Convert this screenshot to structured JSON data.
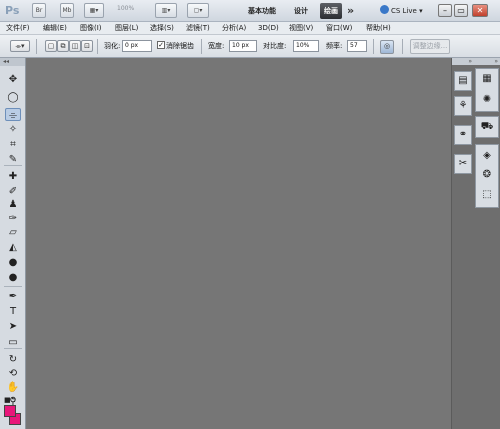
{
  "appbar": {
    "logo": "Ps",
    "mb_label": "Mb",
    "zoom": "100%",
    "workspaces": [
      "基本功能",
      "设计",
      "绘画"
    ],
    "active_workspace": "绘画",
    "more": "»",
    "cs_live": "CS Live",
    "window_controls": [
      "minimize",
      "restore",
      "close"
    ]
  },
  "menu": {
    "items": [
      "文件(F)",
      "编辑(E)",
      "图像(I)",
      "图层(L)",
      "选择(S)",
      "滤镜(T)",
      "分析(A)",
      "3D(D)",
      "视图(V)",
      "窗口(W)",
      "帮助(H)"
    ]
  },
  "options": {
    "feather_label": "羽化:",
    "feather_value": "0 px",
    "antialias_label": "消除锯齿",
    "antialias_checked": true,
    "width_label": "宽度:",
    "width_value": "10 px",
    "contrast_label": "对比度:",
    "contrast_value": "10%",
    "frequency_label": "频率:",
    "frequency_value": "57",
    "refine_edge_label": "调整边缘..."
  },
  "toolbox": {
    "tools": [
      {
        "name": "move-tool",
        "icon": "move-icon",
        "glyph": "✥"
      },
      {
        "name": "marquee-tool",
        "icon": "ellipse-marquee-icon",
        "glyph": "◯"
      },
      {
        "name": "magnetic-lasso-tool",
        "icon": "magnetic-lasso-icon",
        "glyph": "⌯",
        "active": true
      },
      {
        "name": "quick-selection-tool",
        "icon": "magic-wand-icon",
        "glyph": "✧"
      },
      {
        "name": "crop-tool",
        "icon": "crop-icon",
        "glyph": "⌗"
      },
      {
        "name": "eyedropper-tool",
        "icon": "eyedropper-icon",
        "glyph": "✎"
      },
      {
        "name": "spot-healing-tool",
        "icon": "bandage-icon",
        "glyph": "✚"
      },
      {
        "name": "brush-tool",
        "icon": "brush-icon",
        "glyph": "✐"
      },
      {
        "name": "clone-stamp-tool",
        "icon": "stamp-icon",
        "glyph": "♟"
      },
      {
        "name": "history-brush-tool",
        "icon": "history-brush-icon",
        "glyph": "✑"
      },
      {
        "name": "eraser-tool",
        "icon": "eraser-icon",
        "glyph": "▱"
      },
      {
        "name": "paint-bucket-tool",
        "icon": "paint-bucket-icon",
        "glyph": "◭"
      },
      {
        "name": "blur-tool",
        "icon": "blur-drop-icon",
        "glyph": "●"
      },
      {
        "name": "dodge-tool",
        "icon": "dodge-icon",
        "glyph": "●"
      },
      {
        "name": "pen-tool",
        "icon": "pen-icon",
        "glyph": "✒"
      },
      {
        "name": "type-tool",
        "icon": "type-icon",
        "glyph": "T"
      },
      {
        "name": "path-selection-tool",
        "icon": "path-select-icon",
        "glyph": "➤"
      },
      {
        "name": "rectangle-tool",
        "icon": "rectangle-icon",
        "glyph": "▭"
      },
      {
        "name": "3d-rotate-tool",
        "icon": "3d-rotate-icon",
        "glyph": "↻"
      },
      {
        "name": "3d-orbit-tool",
        "icon": "3d-orbit-icon",
        "glyph": "⟲"
      },
      {
        "name": "hand-tool",
        "icon": "hand-icon",
        "glyph": "✋"
      },
      {
        "name": "zoom-tool",
        "icon": "zoom-icon",
        "glyph": "⚲"
      }
    ],
    "foreground_color": "#e8177a",
    "background_color": "#e8177a"
  },
  "dock": {
    "column1": [
      {
        "name": "histogram-panel",
        "icon": "histogram-icon",
        "glyph": "▤"
      },
      {
        "name": "brush-presets-panel",
        "icon": "brushes-icon",
        "glyph": "⚘"
      },
      {
        "name": "clone-source-panel",
        "icon": "clone-source-icon",
        "glyph": "⚭"
      },
      {
        "name": "tool-presets-panel",
        "icon": "tool-presets-icon",
        "glyph": "✂"
      }
    ],
    "column2": [
      {
        "name": "swatches-panel",
        "icon": "swatches-icon",
        "glyph": "▦"
      },
      {
        "name": "adjustments-panel",
        "icon": "adjustments-icon",
        "glyph": "✺"
      },
      {
        "name": "navigator-panel",
        "icon": "navigator-icon",
        "glyph": "⛟"
      },
      {
        "name": "layers-panel",
        "icon": "layers-icon",
        "glyph": "◈"
      },
      {
        "name": "channels-panel",
        "icon": "channels-icon",
        "glyph": "❂"
      },
      {
        "name": "paths-panel",
        "icon": "paths-icon",
        "glyph": "⬚"
      }
    ]
  }
}
